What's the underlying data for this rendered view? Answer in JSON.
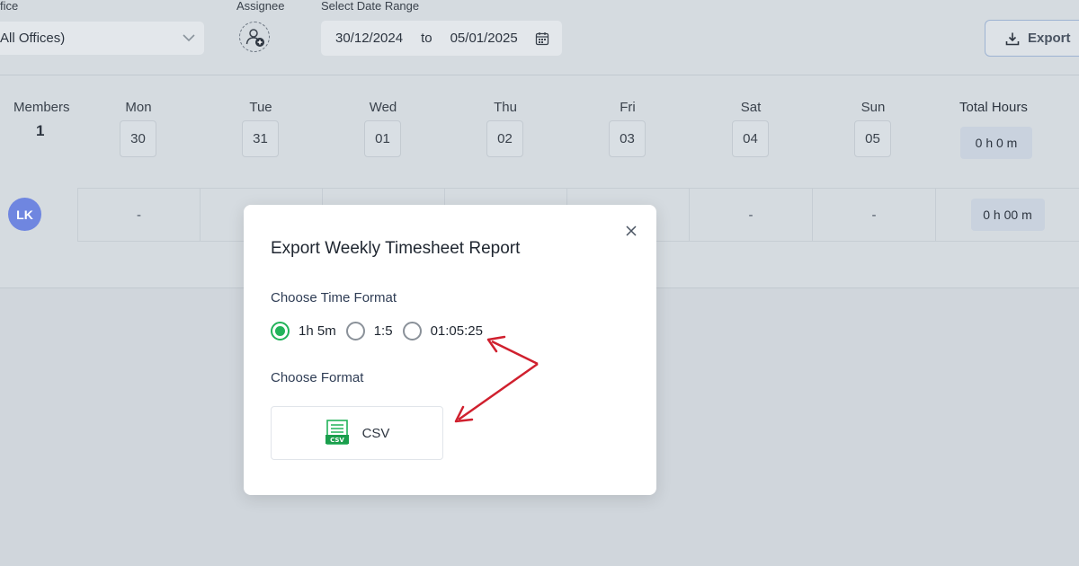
{
  "filters": {
    "office_label": "fice",
    "office_value": "All Offices)",
    "assignee_label": "Assignee",
    "date_range_label": "Select Date Range",
    "date_from": "30/12/2024",
    "date_to_word": "to",
    "date_to": "05/01/2025",
    "export_label": "Export"
  },
  "grid": {
    "members_label": "Members",
    "members_count": "1",
    "days": [
      {
        "name": "Mon",
        "date": "30"
      },
      {
        "name": "Tue",
        "date": "31"
      },
      {
        "name": "Wed",
        "date": "01"
      },
      {
        "name": "Thu",
        "date": "02"
      },
      {
        "name": "Fri",
        "date": "03"
      },
      {
        "name": "Sat",
        "date": "04"
      },
      {
        "name": "Sun",
        "date": "05"
      }
    ],
    "total_label": "Total Hours",
    "total_hours": "0 h 0 m",
    "row": {
      "initials": "LK",
      "cells": [
        "-",
        "-",
        "-"
      ],
      "total": "0 h 00 m"
    }
  },
  "modal": {
    "title": "Export Weekly Timesheet Report",
    "time_format_label": "Choose Time Format",
    "time_formats": [
      {
        "label": "1h 5m",
        "selected": true
      },
      {
        "label": "1:5",
        "selected": false
      },
      {
        "label": "01:05:25",
        "selected": false
      }
    ],
    "format_label": "Choose Format",
    "csv_label": "CSV",
    "csv_icon_text": "CSV"
  },
  "colors": {
    "accent_green": "#22b35a",
    "annotation_red": "#d0202e",
    "avatar_blue": "#6f86e0"
  },
  "icons": [
    "chevron-down-icon",
    "add-user-icon",
    "calendar-icon",
    "download-icon",
    "close-icon",
    "csv-file-icon"
  ]
}
